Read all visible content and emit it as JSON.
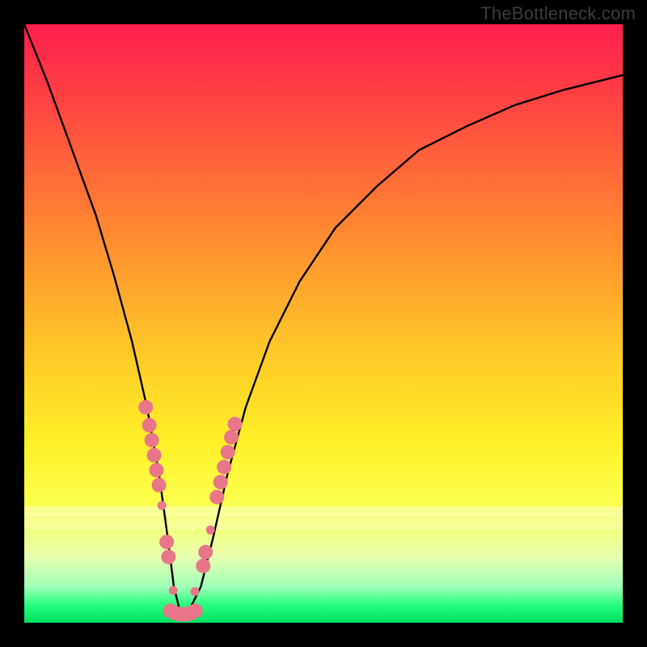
{
  "watermark": "TheBottleneck.com",
  "chart_data": {
    "type": "line",
    "title": "",
    "xlabel": "",
    "ylabel": "",
    "x_range": [
      0,
      100
    ],
    "y_range": [
      0,
      100
    ],
    "annotations": [],
    "series": [
      {
        "name": "bottleneck-curve",
        "color": "#000000",
        "x": [
          0,
          4,
          8,
          12,
          15,
          18,
          20.5,
          22.5,
          24,
          25,
          26,
          27.5,
          29.5,
          31.5,
          34,
          37,
          41,
          46,
          52,
          59,
          66,
          74,
          82,
          90,
          98,
          100
        ],
        "y": [
          100,
          90,
          79,
          68,
          58,
          47,
          36,
          25,
          14,
          6,
          2,
          2,
          6,
          14,
          25,
          36,
          47,
          57,
          66,
          73,
          79,
          83,
          86.5,
          89,
          91,
          91.5
        ]
      }
    ],
    "markers": {
      "name": "highlighted-points",
      "color": "#e87688",
      "radius_large": 9,
      "radius_small": 5.5,
      "points": [
        {
          "x": 20.3,
          "y": 36.0,
          "r": "large"
        },
        {
          "x": 20.9,
          "y": 33.0,
          "r": "large"
        },
        {
          "x": 21.3,
          "y": 30.5,
          "r": "large"
        },
        {
          "x": 21.7,
          "y": 28.0,
          "r": "large"
        },
        {
          "x": 22.1,
          "y": 25.5,
          "r": "large"
        },
        {
          "x": 22.5,
          "y": 23.0,
          "r": "large"
        },
        {
          "x": 23.0,
          "y": 19.6,
          "r": "small"
        },
        {
          "x": 23.8,
          "y": 13.5,
          "r": "large"
        },
        {
          "x": 24.1,
          "y": 11.0,
          "r": "large"
        },
        {
          "x": 24.9,
          "y": 5.4,
          "r": "small"
        },
        {
          "x": 24.4,
          "y": 2.0,
          "r": "large"
        },
        {
          "x": 25.0,
          "y": 1.7,
          "r": "large"
        },
        {
          "x": 25.6,
          "y": 1.5,
          "r": "large"
        },
        {
          "x": 26.2,
          "y": 1.4,
          "r": "large"
        },
        {
          "x": 26.8,
          "y": 1.4,
          "r": "large"
        },
        {
          "x": 27.4,
          "y": 1.5,
          "r": "large"
        },
        {
          "x": 28.0,
          "y": 1.7,
          "r": "large"
        },
        {
          "x": 28.6,
          "y": 2.0,
          "r": "large"
        },
        {
          "x": 28.5,
          "y": 5.2,
          "r": "small"
        },
        {
          "x": 29.9,
          "y": 9.5,
          "r": "large"
        },
        {
          "x": 30.3,
          "y": 11.8,
          "r": "large"
        },
        {
          "x": 31.1,
          "y": 15.5,
          "r": "small"
        },
        {
          "x": 32.2,
          "y": 21.0,
          "r": "large"
        },
        {
          "x": 32.8,
          "y": 23.5,
          "r": "large"
        },
        {
          "x": 33.4,
          "y": 26.0,
          "r": "large"
        },
        {
          "x": 34.0,
          "y": 28.5,
          "r": "large"
        },
        {
          "x": 34.6,
          "y": 31.0,
          "r": "large"
        },
        {
          "x": 35.2,
          "y": 33.2,
          "r": "large"
        }
      ]
    },
    "gradient_stops": [
      {
        "pos": 0,
        "color": "#ff1e4f"
      },
      {
        "pos": 10,
        "color": "#ff3a44"
      },
      {
        "pos": 25,
        "color": "#ff6a39"
      },
      {
        "pos": 40,
        "color": "#ff9a2e"
      },
      {
        "pos": 55,
        "color": "#ffc928"
      },
      {
        "pos": 70,
        "color": "#fff028"
      },
      {
        "pos": 80,
        "color": "#fbff4d"
      },
      {
        "pos": 89,
        "color": "#e7ffb0"
      },
      {
        "pos": 94,
        "color": "#9fffb8"
      },
      {
        "pos": 97,
        "color": "#28ff7e"
      },
      {
        "pos": 100,
        "color": "#00e060"
      }
    ],
    "bands": [
      {
        "top_pct": 80.5,
        "height_pct": 2.0,
        "color": "rgba(255,255,255,0.35)"
      },
      {
        "top_pct": 82.5,
        "height_pct": 2.0,
        "color": "rgba(255,255,255,0.25)"
      }
    ]
  }
}
